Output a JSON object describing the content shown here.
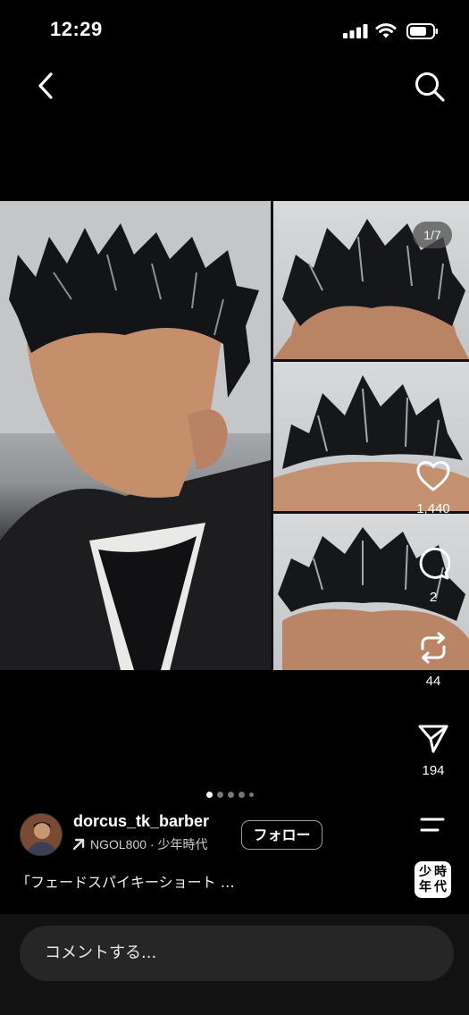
{
  "status_bar": {
    "time": "12:29"
  },
  "nav": {
    "back_icon": "chevron-left-icon",
    "search_icon": "search-icon"
  },
  "media": {
    "page_counter": "1/7",
    "total_pages": 7,
    "current_page": 1
  },
  "actions": {
    "like_count": "1,440",
    "comment_count": "2",
    "repost_count": "44",
    "share_count": "194"
  },
  "author": {
    "username": "dorcus_tk_barber",
    "music_text": "NGOL800 · 少年時代",
    "follow_label": "フォロー"
  },
  "post": {
    "caption": "「フェードスパイキーショート …"
  },
  "music_tile": {
    "chars": [
      "少",
      "時",
      "年",
      "代"
    ]
  },
  "comment_bar": {
    "placeholder": "コメントする..."
  }
}
